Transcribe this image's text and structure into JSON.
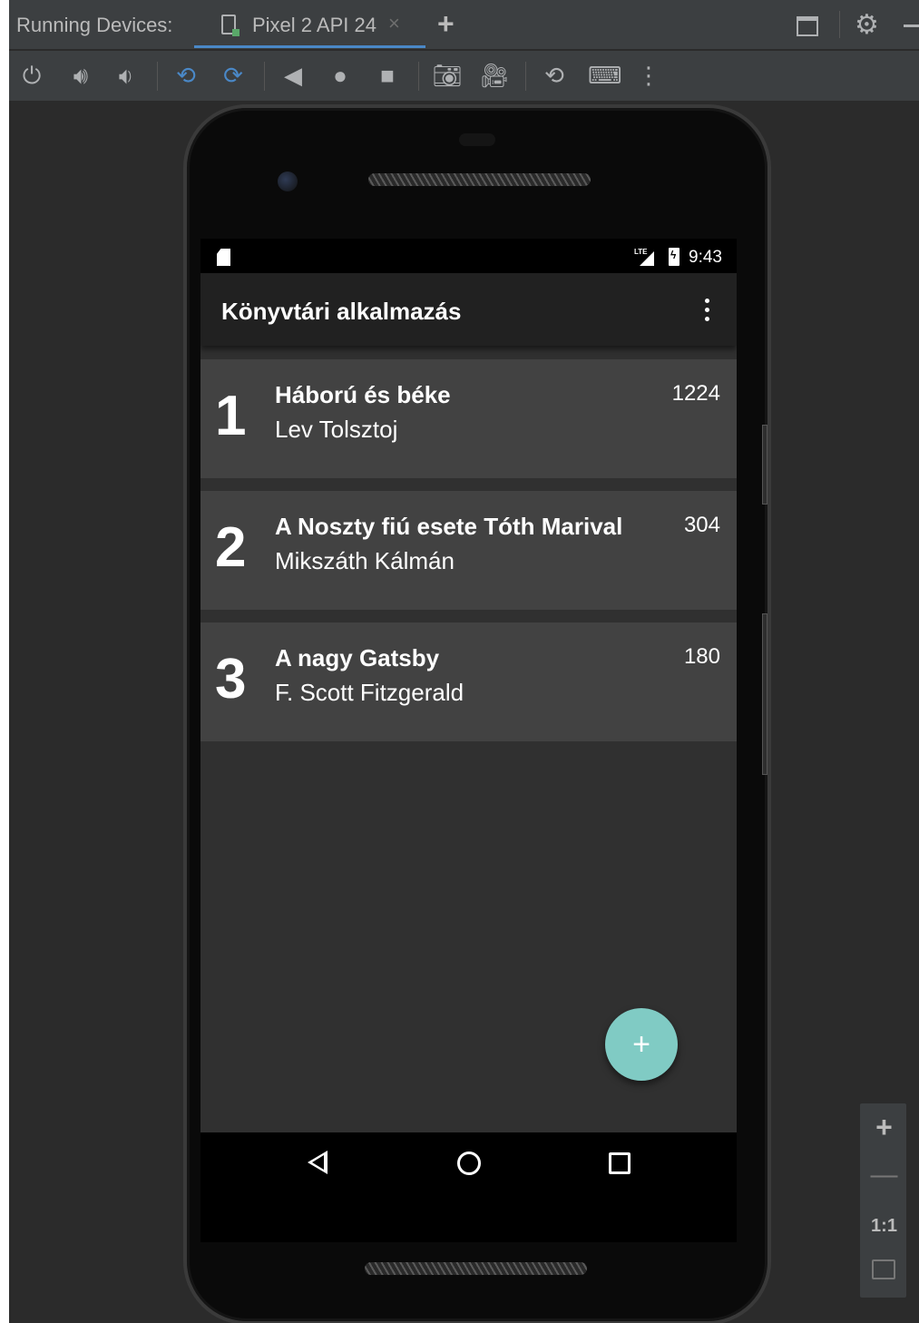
{
  "ide": {
    "panel_title": "Running Devices:",
    "device_tab": {
      "label": "Pixel 2 API 24",
      "close": "×"
    },
    "add_tab": "+",
    "colors": {
      "background": "#2b2b2b",
      "toolbar": "#3c3f41",
      "accent": "#4a88c7"
    },
    "toolbar_icons": [
      "power-icon",
      "volume-up-icon",
      "volume-down-icon",
      "rotate-left-icon",
      "rotate-right-icon",
      "back-icon",
      "home-icon",
      "overview-icon",
      "screenshot-icon",
      "screen-record-icon",
      "snapshot-icon",
      "keyboard-icon",
      "more-options-icon"
    ]
  },
  "device": {
    "status_bar": {
      "time": "9:43",
      "network": "LTE"
    },
    "app_bar": {
      "title": "Könyvtári alkalmazás"
    },
    "books": [
      {
        "num": "1",
        "title": "Háború és béke",
        "author": "Lev Tolsztoj",
        "pages": "1224"
      },
      {
        "num": "2",
        "title": "A Noszty fiú esete Tóth Marival",
        "author": "Mikszáth Kálmán",
        "pages": "304"
      },
      {
        "num": "3",
        "title": "A nagy Gatsby",
        "author": "F. Scott Fitzgerald",
        "pages": "180"
      }
    ],
    "fab": {
      "label": "+",
      "color": "#80cbc4"
    },
    "colors": {
      "screen_bg": "#303030",
      "card_bg": "#424242",
      "app_bar_bg": "#212121"
    }
  },
  "zoom_panel": {
    "zoom_in": "+",
    "zoom_out": "—",
    "actual_size": "1:1"
  }
}
